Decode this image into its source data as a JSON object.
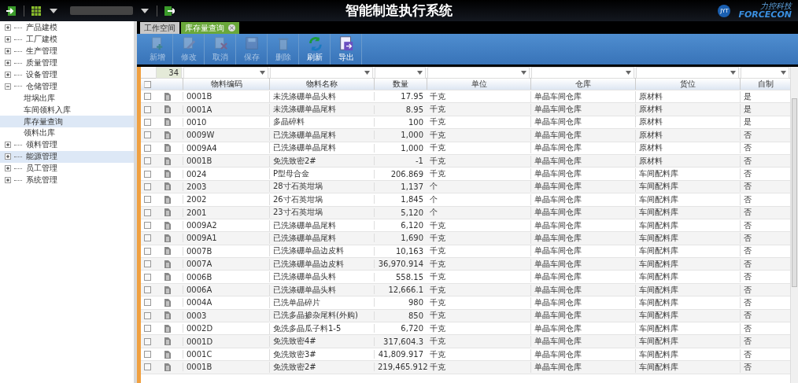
{
  "header": {
    "title": "智能制造执行系统",
    "logo_small": "JYT",
    "logo_cn": "力控科技",
    "logo_en": "FORCECON"
  },
  "sidebar": {
    "items": [
      {
        "label": "产品建模",
        "expanded": false,
        "highlighted": false
      },
      {
        "label": "工厂建模",
        "expanded": false,
        "highlighted": false
      },
      {
        "label": "生产管理",
        "expanded": false,
        "highlighted": false
      },
      {
        "label": "质量管理",
        "expanded": false,
        "highlighted": false
      },
      {
        "label": "设备管理",
        "expanded": false,
        "highlighted": false
      },
      {
        "label": "仓储管理",
        "expanded": true,
        "highlighted": false,
        "children": [
          {
            "label": "坩埚出库",
            "selected": false
          },
          {
            "label": "车间领料入库",
            "selected": false
          },
          {
            "label": "库存量查询",
            "selected": true
          },
          {
            "label": "领料出库",
            "selected": false
          }
        ]
      },
      {
        "label": "领料管理",
        "expanded": false,
        "highlighted": false
      },
      {
        "label": "能源管理",
        "expanded": false,
        "highlighted": true
      },
      {
        "label": "员工管理",
        "expanded": false,
        "highlighted": false
      },
      {
        "label": "系统管理",
        "expanded": false,
        "highlighted": false
      }
    ]
  },
  "tabs": [
    {
      "label": "工作空间",
      "selected": false,
      "closable": false
    },
    {
      "label": "库存量查询",
      "selected": true,
      "closable": true
    }
  ],
  "toolbar": [
    {
      "kind": "add",
      "label": "新增",
      "disabled": true
    },
    {
      "kind": "edit",
      "label": "修改",
      "disabled": true
    },
    {
      "kind": "cancel",
      "label": "取消",
      "disabled": true
    },
    {
      "kind": "save",
      "label": "保存",
      "disabled": true
    },
    {
      "kind": "delete",
      "label": "删除",
      "disabled": true
    },
    {
      "kind": "refresh",
      "label": "刷新",
      "disabled": false
    },
    {
      "kind": "export",
      "label": "导出",
      "disabled": false
    }
  ],
  "table": {
    "page_size": "34",
    "all_checked": false,
    "columns": [
      "物料编码",
      "物料名称",
      "数量",
      "单位",
      "仓库",
      "货位",
      "自制"
    ],
    "rows": [
      {
        "code": "0001B",
        "name": "未洗涤硼单晶头料",
        "qty": "17.95",
        "unit": "千克",
        "warehouse": "单晶车间仓库",
        "location": "原材料",
        "self_made": "是",
        "checked": false
      },
      {
        "code": "0001A",
        "name": "未洗涤硼单晶尾料",
        "qty": "8.95",
        "unit": "千克",
        "warehouse": "单晶车间仓库",
        "location": "原材料",
        "self_made": "是",
        "checked": false
      },
      {
        "code": "0010",
        "name": "多晶碎料",
        "qty": "100",
        "unit": "千克",
        "warehouse": "单晶车间仓库",
        "location": "原材料",
        "self_made": "是",
        "checked": false
      },
      {
        "code": "0009W",
        "name": "已洗涤硼单晶尾料",
        "qty": "1,000",
        "unit": "千克",
        "warehouse": "单晶车间仓库",
        "location": "原材料",
        "self_made": "否",
        "checked": false
      },
      {
        "code": "0009A4",
        "name": "已洗涤硼单晶尾料",
        "qty": "1,000",
        "unit": "千克",
        "warehouse": "单晶车间仓库",
        "location": "原材料",
        "self_made": "否",
        "checked": false
      },
      {
        "code": "0001B",
        "name": "免洗致密2#",
        "qty": "-1",
        "unit": "千克",
        "warehouse": "单晶车间仓库",
        "location": "原材料",
        "self_made": "否",
        "checked": false
      },
      {
        "code": "0024",
        "name": "P型母合金",
        "qty": "206.869",
        "unit": "千克",
        "warehouse": "单晶车间仓库",
        "location": "车间配料库",
        "self_made": "否",
        "checked": false
      },
      {
        "code": "2003",
        "name": "28寸石英坩埚",
        "qty": "1,137",
        "unit": "个",
        "warehouse": "单晶车间仓库",
        "location": "车间配料库",
        "self_made": "否",
        "checked": false
      },
      {
        "code": "2002",
        "name": "26寸石英坩埚",
        "qty": "1,845",
        "unit": "个",
        "warehouse": "单晶车间仓库",
        "location": "车间配料库",
        "self_made": "否",
        "checked": false
      },
      {
        "code": "2001",
        "name": "23寸石英坩埚",
        "qty": "5,120",
        "unit": "个",
        "warehouse": "单晶车间仓库",
        "location": "车间配料库",
        "self_made": "否",
        "checked": false
      },
      {
        "code": "0009A2",
        "name": "已洗涤硼单晶尾料",
        "qty": "6,120",
        "unit": "千克",
        "warehouse": "单晶车间仓库",
        "location": "车间配料库",
        "self_made": "否",
        "checked": false
      },
      {
        "code": "0009A1",
        "name": "已洗涤硼单晶尾料",
        "qty": "1,690",
        "unit": "千克",
        "warehouse": "单晶车间仓库",
        "location": "车间配料库",
        "self_made": "否",
        "checked": false
      },
      {
        "code": "0007B",
        "name": "已洗涤硼单晶边皮料",
        "qty": "10,163",
        "unit": "千克",
        "warehouse": "单晶车间仓库",
        "location": "车间配料库",
        "self_made": "否",
        "checked": false
      },
      {
        "code": "0007A",
        "name": "已洗涤硼单晶边皮料",
        "qty": "36,970.914",
        "unit": "千克",
        "warehouse": "单晶车间仓库",
        "location": "车间配料库",
        "self_made": "否",
        "checked": false
      },
      {
        "code": "0006B",
        "name": "已洗涤硼单晶头料",
        "qty": "558.15",
        "unit": "千克",
        "warehouse": "单晶车间仓库",
        "location": "车间配料库",
        "self_made": "否",
        "checked": false
      },
      {
        "code": "0006A",
        "name": "已洗涤硼单晶头料",
        "qty": "12,666.1",
        "unit": "千克",
        "warehouse": "单晶车间仓库",
        "location": "车间配料库",
        "self_made": "否",
        "checked": false
      },
      {
        "code": "0004A",
        "name": "已洗单晶碎片",
        "qty": "980",
        "unit": "千克",
        "warehouse": "单晶车间仓库",
        "location": "车间配料库",
        "self_made": "否",
        "checked": false
      },
      {
        "code": "0003",
        "name": "已洗多晶掺杂尾料(外购)",
        "qty": "850",
        "unit": "千克",
        "warehouse": "单晶车间仓库",
        "location": "车间配料库",
        "self_made": "否",
        "checked": false
      },
      {
        "code": "0002D",
        "name": "免洗多晶瓜子料1-5",
        "qty": "6,720",
        "unit": "千克",
        "warehouse": "单晶车间仓库",
        "location": "车间配料库",
        "self_made": "否",
        "checked": false
      },
      {
        "code": "0001D",
        "name": "免洗致密4#",
        "qty": "317,604.3",
        "unit": "千克",
        "warehouse": "单晶车间仓库",
        "location": "车间配料库",
        "self_made": "否",
        "checked": false
      },
      {
        "code": "0001C",
        "name": "免洗致密3#",
        "qty": "41,809.917",
        "unit": "千克",
        "warehouse": "单晶车间仓库",
        "location": "车间配料库",
        "self_made": "否",
        "checked": false
      },
      {
        "code": "0001B",
        "name": "免洗致密2#",
        "qty": "219,465.912",
        "unit": "千克",
        "warehouse": "单晶车间仓库",
        "location": "车间配料库",
        "self_made": "否",
        "checked": false
      }
    ]
  }
}
